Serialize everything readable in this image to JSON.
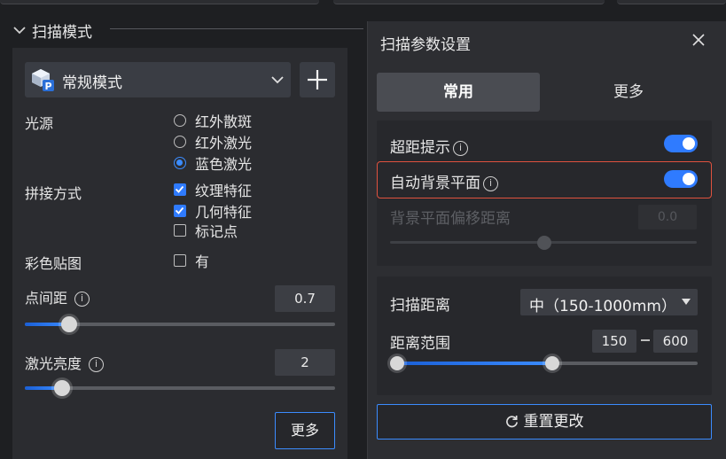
{
  "left": {
    "section_title": "扫描模式",
    "mode": {
      "label": "常规模式",
      "icon": "cube-p-icon"
    },
    "light_source": {
      "label": "光源",
      "options": [
        {
          "label": "红外散斑",
          "selected": false
        },
        {
          "label": "红外激光",
          "selected": false
        },
        {
          "label": "蓝色激光",
          "selected": true
        }
      ]
    },
    "stitch": {
      "label": "拼接方式",
      "options": [
        {
          "label": "纹理特征",
          "checked": true
        },
        {
          "label": "几何特征",
          "checked": true
        },
        {
          "label": "标记点",
          "checked": false
        }
      ]
    },
    "color_texture": {
      "label": "彩色贴图",
      "option": "有",
      "checked": false
    },
    "point_spacing": {
      "label": "点间距",
      "value": "0.7",
      "slider_fraction": 0.15
    },
    "laser_brightness": {
      "label": "激光亮度",
      "value": "2",
      "slider_fraction": 0.12
    },
    "more_button": "更多"
  },
  "dialog": {
    "title": "扫描参数设置",
    "tabs": [
      {
        "label": "常用",
        "active": true
      },
      {
        "label": "更多",
        "active": false
      }
    ],
    "over_distance_hint": {
      "label": "超距提示",
      "on": true
    },
    "auto_background_plane": {
      "label": "自动背景平面",
      "on": true
    },
    "background_offset": {
      "label": "背景平面偏移距离",
      "value": "0.0",
      "disabled": true,
      "slider_fraction": 0.5
    },
    "scan_distance": {
      "label": "扫描距离",
      "value": "中（150-1000mm）"
    },
    "distance_range": {
      "label": "距离范围",
      "min": "150",
      "max": "600",
      "low_fraction": 0.0,
      "high_fraction": 0.5
    },
    "reset_button": "重置更改"
  },
  "colors": {
    "accent": "#2f7bff",
    "highlight": "#e0523f",
    "panel": "#2b2c30"
  }
}
